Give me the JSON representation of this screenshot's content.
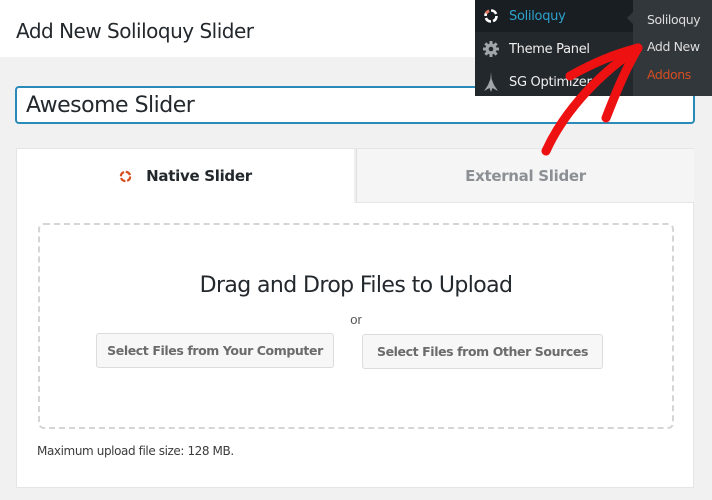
{
  "header": {
    "title": "Add New Soliloquy Slider"
  },
  "title_field": {
    "value": "Awesome Slider"
  },
  "tabs": [
    {
      "label": "Native Slider",
      "icon": "soliloquy-ring-icon",
      "active": true
    },
    {
      "label": "External Slider",
      "active": false
    }
  ],
  "upload": {
    "title": "Drag and Drop Files to Upload",
    "or_label": "or",
    "select_computer_label": "Select Files from Your Computer",
    "select_other_label": "Select Files from Other Sources",
    "max_size_note": "Maximum upload file size: 128 MB."
  },
  "admin_menu": {
    "items": [
      {
        "label": "Soliloquy",
        "icon": "soliloquy-ring-icon",
        "active": true
      },
      {
        "label": "Theme Panel",
        "icon": "gear-icon",
        "active": false
      },
      {
        "label": "SG Optimizer",
        "icon": "sg-optimizer-icon",
        "active": false
      }
    ],
    "submenu": [
      {
        "label": "Soliloquy"
      },
      {
        "label": "Add New"
      },
      {
        "label": "Addons"
      }
    ]
  },
  "colors": {
    "accent": "#2a8bb8",
    "menu_bg": "#23282d",
    "submenu_bg": "#32373c",
    "active_menu_text": "#2ea2cc",
    "addons_text": "#d54e21",
    "annotation_arrow": "#ee1111",
    "soliloquy_icon": "#d54e21"
  }
}
